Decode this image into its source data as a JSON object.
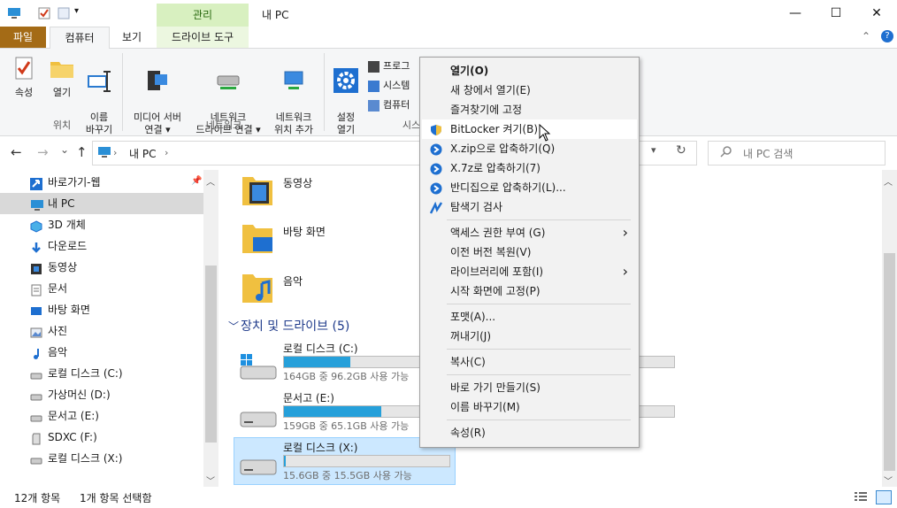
{
  "window": {
    "title": "내 PC",
    "context_tab": "관리",
    "min_glyph": "—",
    "max_glyph": "☐",
    "close_glyph": "✕"
  },
  "ribbon_tabs": [
    "파일",
    "컴퓨터",
    "보기",
    "드라이브 도구"
  ],
  "ribbon": {
    "groups": [
      {
        "label": "위치",
        "buttons": [
          "속성",
          "열기",
          "이름\n바꾸기"
        ]
      },
      {
        "label": "네트워크",
        "buttons": [
          "미디어 서버\n연결 ▾",
          "네트워크\n드라이브 연결 ▾",
          "네트워크\n위치 추가"
        ]
      },
      {
        "label": "시스",
        "buttons": [
          "설정\n열기"
        ],
        "small": [
          "프로그",
          "시스템",
          "컴퓨터"
        ]
      }
    ]
  },
  "nav": {
    "back": "←",
    "forward": "→",
    "recent": "⌄",
    "up": "↑",
    "address": [
      "내 PC",
      "›"
    ],
    "refresh": "↻",
    "search_placeholder": "내 PC 검색"
  },
  "tree": [
    {
      "label": "바로가기-웹",
      "icon": "quick-access-icon"
    },
    {
      "label": "내 PC",
      "icon": "computer-icon",
      "selected": true
    },
    {
      "label": "3D 개체",
      "icon": "cube-icon"
    },
    {
      "label": "다운로드",
      "icon": "download-arrow-icon"
    },
    {
      "label": "동영상",
      "icon": "video-icon"
    },
    {
      "label": "문서",
      "icon": "document-icon"
    },
    {
      "label": "바탕 화면",
      "icon": "desktop-icon"
    },
    {
      "label": "사진",
      "icon": "picture-icon"
    },
    {
      "label": "음악",
      "icon": "music-note-icon"
    },
    {
      "label": "로컬 디스크 (C:)",
      "icon": "drive-icon"
    },
    {
      "label": "가상머신 (D:)",
      "icon": "drive-icon"
    },
    {
      "label": "문서고 (E:)",
      "icon": "drive-icon"
    },
    {
      "label": "SDXC (F:)",
      "icon": "sd-card-icon"
    },
    {
      "label": "로컬 디스크 (X:)",
      "icon": "drive-icon"
    }
  ],
  "folders": [
    {
      "label": "동영상",
      "icon": "video-folder-icon"
    },
    {
      "label": "바탕 화면",
      "icon": "desktop-folder-icon"
    },
    {
      "label": "음악",
      "icon": "music-folder-icon"
    }
  ],
  "devices": {
    "header": "장치 및 드라이브 (5)",
    "drives": [
      {
        "label": "로컬 디스크 (C:)",
        "info": "164GB 중 96.2GB 사용 가능",
        "used_fraction": 0.41
      },
      {
        "label": "문서고 (E:)",
        "info": "159GB 중 65.1GB 사용 가능",
        "used_fraction": 0.59
      },
      {
        "label": "로컬 디스크 (X:)",
        "info": "15.6GB 중 15.5GB 사용 가능",
        "used_fraction": 0.01,
        "selected": true
      }
    ]
  },
  "context_menu": [
    {
      "label": "열기(O)",
      "bold": true
    },
    {
      "label": "새 창에서 열기(E)"
    },
    {
      "label": "즐겨찾기에 고정"
    },
    {
      "label": "BitLocker 켜기(B)",
      "icon": "shield-icon",
      "hover": true
    },
    {
      "label": "X.zip으로 압축하기(Q)",
      "icon": "bandizip-icon"
    },
    {
      "label": "X.7z로 압축하기(7)",
      "icon": "bandizip-icon"
    },
    {
      "label": "반디집으로 압축하기(L)...",
      "icon": "bandizip-icon"
    },
    {
      "label": "탐색기 검사",
      "icon": "scan-icon"
    },
    {
      "sep": true
    },
    {
      "label": "액세스 권한 부여 (G)",
      "submenu": true
    },
    {
      "label": "이전 버전 복원(V)"
    },
    {
      "label": "라이브러리에 포함(I)",
      "submenu": true
    },
    {
      "label": "시작 화면에 고정(P)"
    },
    {
      "sep": true
    },
    {
      "label": "포맷(A)..."
    },
    {
      "label": "꺼내기(J)"
    },
    {
      "sep": true
    },
    {
      "label": "복사(C)"
    },
    {
      "sep": true
    },
    {
      "label": "바로 가기 만들기(S)"
    },
    {
      "label": "이름 바꾸기(M)"
    },
    {
      "sep": true
    },
    {
      "label": "속성(R)"
    }
  ],
  "submenu_arrow": "›",
  "status": {
    "items": "12개 항목",
    "selected": "1개 항목 선택함"
  },
  "colors": {
    "file_tab": "#a46b16",
    "context_tab": "#d8f0c0",
    "drive_fill": "#26a0da",
    "selection": "#cce8ff"
  }
}
